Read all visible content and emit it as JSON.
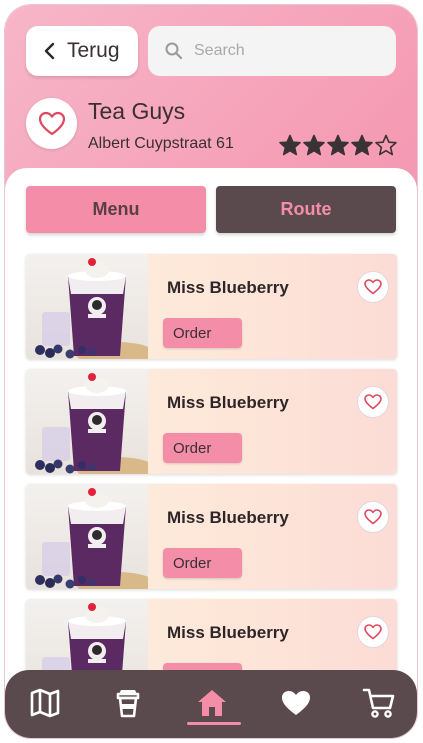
{
  "header": {
    "back_label": "Terug",
    "search_placeholder": "Search"
  },
  "store": {
    "name": "Tea Guys",
    "address": "Albert Cuypstraat 61",
    "rating": 4,
    "rating_max": 5
  },
  "tabs": [
    {
      "label": "Menu",
      "active": true
    },
    {
      "label": "Route",
      "active": false
    }
  ],
  "products": [
    {
      "name": "Miss Blueberry",
      "order_label": "Order",
      "image": "blueberry-bubble-tea"
    },
    {
      "name": "Miss Blueberry",
      "order_label": "Order",
      "image": "blueberry-bubble-tea"
    },
    {
      "name": "Miss Blueberry",
      "order_label": "Order",
      "image": "blueberry-bubble-tea"
    },
    {
      "name": "Miss Blueberry",
      "order_label": "Order",
      "image": "blueberry-bubble-tea"
    }
  ],
  "bottom_nav": [
    {
      "icon": "map-icon",
      "active": false
    },
    {
      "icon": "cup-icon",
      "active": false
    },
    {
      "icon": "home-icon",
      "active": true
    },
    {
      "icon": "heart-icon",
      "active": false
    },
    {
      "icon": "cart-icon",
      "active": false
    }
  ],
  "colors": {
    "accent_pink": "#f48ea8",
    "dark_brown": "#5a4a4d",
    "heart_red": "#e0475e",
    "star": "#3a3335"
  }
}
